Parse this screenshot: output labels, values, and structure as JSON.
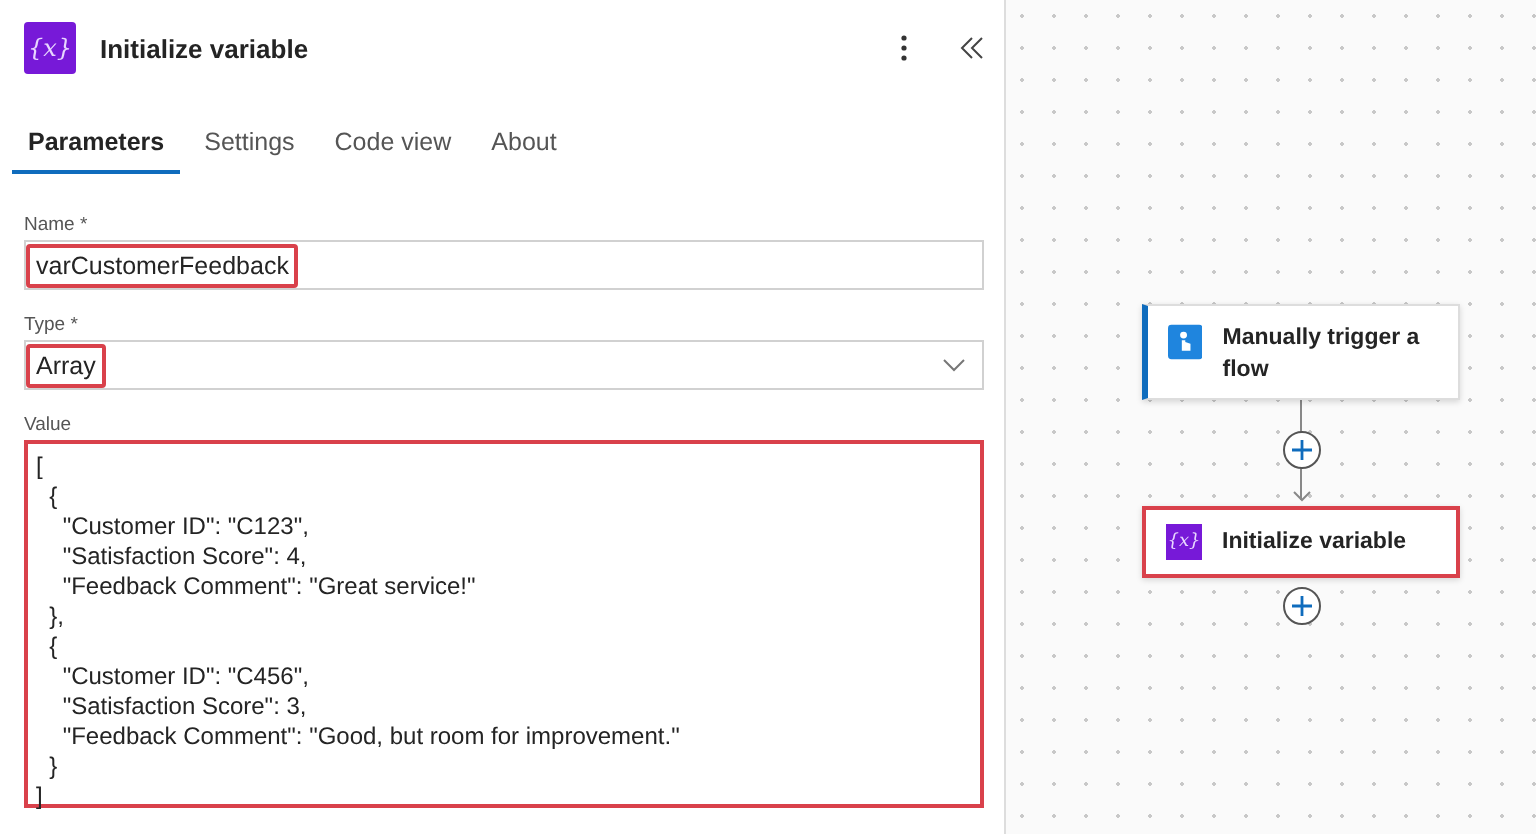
{
  "header": {
    "icon": "{x}",
    "title": "Initialize variable"
  },
  "tabs": [
    {
      "label": "Parameters",
      "selected": true
    },
    {
      "label": "Settings",
      "selected": false
    },
    {
      "label": "Code view",
      "selected": false
    },
    {
      "label": "About",
      "selected": false
    }
  ],
  "fields": {
    "name": {
      "label": "Name *",
      "value": "varCustomerFeedback",
      "highlighted": true
    },
    "type": {
      "label": "Type *",
      "value": "Array",
      "highlighted": true
    },
    "value": {
      "label": "Value",
      "highlighted": true,
      "lines": [
        "[",
        "  {",
        "    \"Customer ID\": \"C123\",",
        "    \"Satisfaction Score\": 4,",
        "    \"Feedback Comment\": \"Great service!\"",
        "  },",
        "  {",
        "    \"Customer ID\": \"C456\",",
        "    \"Satisfaction Score\": 3,",
        "    \"Feedback Comment\": \"Good, but room for improvement.\"",
        "  }",
        "]"
      ]
    }
  },
  "flow": [
    {
      "kind": "trigger",
      "title": "Manually trigger a flow",
      "highlighted": false
    },
    {
      "kind": "variable",
      "icon": "{x}",
      "title": "Initialize variable",
      "highlighted": true
    }
  ]
}
